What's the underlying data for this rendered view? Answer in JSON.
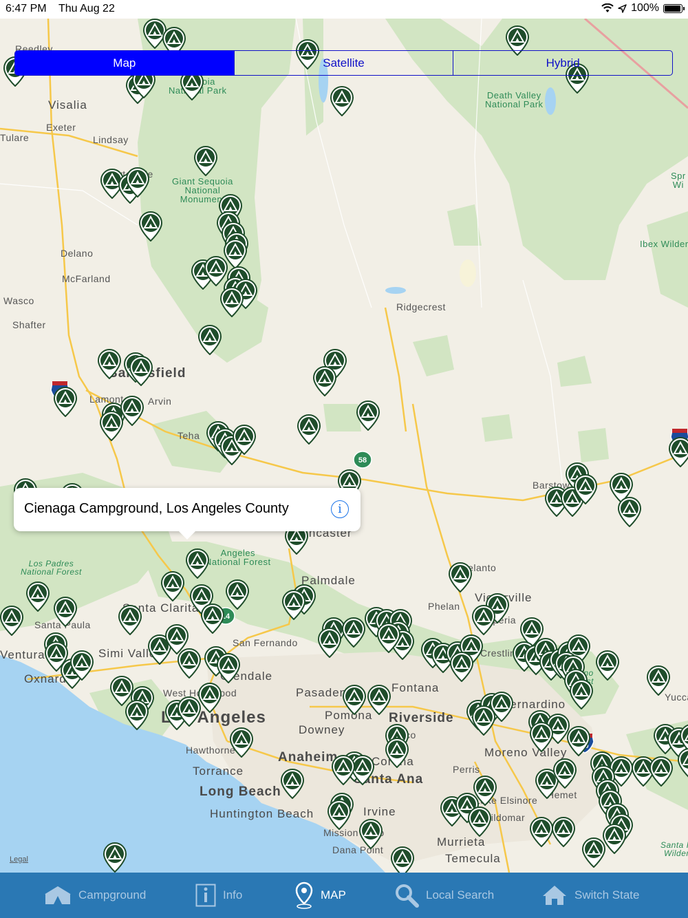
{
  "status_bar": {
    "time": "6:47 PM",
    "date": "Thu Aug 22",
    "battery_text": "100%",
    "battery_level": 1.0
  },
  "map_type_control": {
    "options": [
      "Map",
      "Satellite",
      "Hybrid"
    ],
    "selected": "Map"
  },
  "places": {
    "visalia": "Visalia",
    "tulare": "Tulare",
    "exeter": "Exeter",
    "lindsay": "Lindsay",
    "reedley": "Reedley",
    "porterville": "Porterville",
    "delano": "Delano",
    "mcfarland": "McFarland",
    "wasco": "Wasco",
    "shafter": "Shafter",
    "bakersfield": "Bakersfield",
    "lamont": "Lamont",
    "arvin": "Arvin",
    "tehachapi": "Tehachapi",
    "ridgecrest": "Ridgecrest",
    "lancaster": "Lancaster",
    "palmdale": "Palmdale",
    "adelanto": "Adelanto",
    "victorville": "Victorville",
    "phelan": "Phelan",
    "hesperia": "Hesperia",
    "crestline": "Crestline",
    "barstow": "Barstow",
    "santa_clarita": "Santa Clarita",
    "santa_paula": "Santa Paula",
    "ventura": "Ventura",
    "oxnard": "Oxnard",
    "simi_valley": "Simi Valley",
    "san_fernando": "San Fernando",
    "glendale": "Glendale",
    "west_hollywood": "West Hollywood",
    "pasadena": "Pasadena",
    "los_angeles": "Los Angeles",
    "downey": "Downey",
    "pomona": "Pomona",
    "fontana": "Fontana",
    "san_bernardino": "San Bernardino",
    "riverside": "Riverside",
    "norco": "Norco",
    "corona": "Corona",
    "hawthorne": "Hawthorne",
    "torrance": "Torrance",
    "long_beach": "Long Beach",
    "anaheim": "Anaheim",
    "santa_ana": "Santa Ana",
    "huntington_beach": "Huntington Beach",
    "irvine": "Irvine",
    "mission_viejo": "Mission Viejo",
    "dana_point": "Dana Point",
    "perris": "Perris",
    "moreno_valley": "Moreno Valley",
    "hemet": "Hemet",
    "lake_elsinore": "Lake Elsinore",
    "wildomar": "Wildomar",
    "murrieta": "Murrieta",
    "temecula": "Temecula",
    "yucca": "Yucca",
    "sequoia_np": "Sequoia\nNational Park",
    "giant_sequoia": "Giant Sequoia\nNational\nMonument",
    "death_valley": "Death Valley\nNational Park",
    "angeles_nf": "Angeles\nNational Forest",
    "los_padres": "Los Padres\nNational Forest",
    "ibex": "Ibex Wilder",
    "spring": "Spr\nWi",
    "santa_rosa": "Santa R\nWilder",
    "sb_forest": "ardino\nForest",
    "tejon": "Teha"
  },
  "highways": {
    "i5": "5",
    "sr58": "58",
    "sr14": "14",
    "i15": "15",
    "i10": "10"
  },
  "callout": {
    "title": "Cienaga Campground, Los Angeles County"
  },
  "legal": "Legal",
  "tab_bar": {
    "items": [
      {
        "label": "Campground",
        "icon": "campground-icon"
      },
      {
        "label": "Info",
        "icon": "info-icon"
      },
      {
        "label": "MAP",
        "icon": "map-pin-icon"
      },
      {
        "label": "Local Search",
        "icon": "search-icon"
      },
      {
        "label": "Switch State",
        "icon": "home-icon"
      }
    ],
    "selected": "MAP"
  },
  "colors": {
    "accent": "#0000ff",
    "tabbar": "#2a78b4",
    "pin": "#1f4d2b",
    "water": "#a6d3f2",
    "land": "#f2efe6",
    "park": "#cfe3c0"
  }
}
